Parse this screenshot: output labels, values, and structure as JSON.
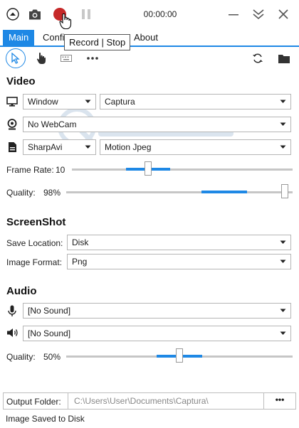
{
  "toolbar": {
    "timer": "00:00:00",
    "tooltip": "Record | Stop",
    "record_color": "#c62828"
  },
  "tabs": [
    {
      "label": "Main",
      "active": true
    },
    {
      "label": "Confi",
      "active": false
    },
    {
      "label": "About",
      "active": false
    }
  ],
  "tools": [
    "pointer-icon",
    "hand-icon",
    "keyboard-icon",
    "more-icon",
    "refresh-icon",
    "folder-icon"
  ],
  "video": {
    "title": "Video",
    "source_type": "Window",
    "source": "Captura",
    "webcam": "No WebCam",
    "writer": "SharpAvi",
    "codec": "Motion Jpeg",
    "frame_rate_label": "Frame Rate:",
    "frame_rate_value": "10",
    "frame_rate_level": 0.34,
    "quality_label": "Quality:",
    "quality_value": "98%",
    "quality_level": 0.98
  },
  "screenshot": {
    "title": "ScreenShot",
    "save_location_label": "Save Location:",
    "save_location": "Disk",
    "image_format_label": "Image Format:",
    "image_format": "Png"
  },
  "audio": {
    "title": "Audio",
    "mic": "[No Sound]",
    "speaker": "[No Sound]",
    "quality_label": "Quality:",
    "quality_value": "50%",
    "quality_level": 0.5
  },
  "output": {
    "label": "Output Folder:",
    "path": "C:\\Users\\User\\Documents\\Captura\\",
    "browse_label": "•••"
  },
  "status": "Image Saved to Disk",
  "accent": "#1e88e5"
}
